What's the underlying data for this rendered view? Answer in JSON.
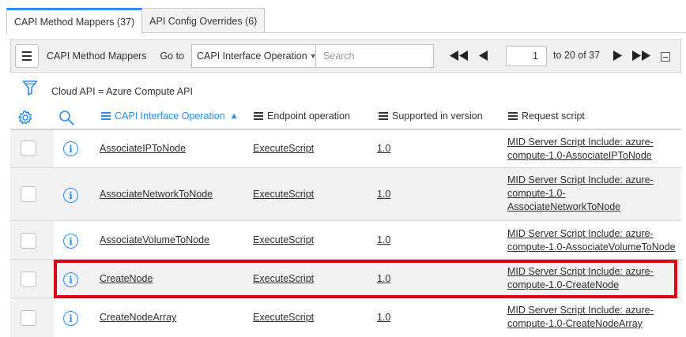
{
  "tabs": [
    {
      "label": "CAPI Method Mappers (37)",
      "active": true
    },
    {
      "label": "API Config Overrides (6)",
      "active": false
    }
  ],
  "toolbar": {
    "title": "CAPI Method Mappers",
    "goto_label": "Go to",
    "goto_field": "CAPI Interface Operation",
    "search_placeholder": "Search",
    "page_value": "1",
    "page_range": "to 20 of 37"
  },
  "filter": {
    "breadcrumb": "Cloud API = Azure Compute API"
  },
  "columns": {
    "operation": "CAPI Interface Operation",
    "endpoint": "Endpoint operation",
    "version": "Supported in version",
    "script": "Request script"
  },
  "rows": [
    {
      "operation": "AssociateIPToNode",
      "endpoint": "ExecuteScript",
      "version": "1.0",
      "script": [
        "MID Server Script Include: azure-",
        "compute-1.0-AssociateIPToNode"
      ]
    },
    {
      "operation": "AssociateNetworkToNode",
      "endpoint": "ExecuteScript",
      "version": "1.0",
      "script": [
        "MID Server Script Include: azure-",
        "compute-1.0-",
        "AssociateNetworkToNode"
      ]
    },
    {
      "operation": "AssociateVolumeToNode",
      "endpoint": "ExecuteScript",
      "version": "1.0",
      "script": [
        "MID Server Script Include: azure-",
        "compute-1.0-AssociateVolumeToNode"
      ]
    },
    {
      "operation": "CreateNode",
      "endpoint": "ExecuteScript",
      "version": "1.0",
      "script": [
        "MID Server Script Include: azure-",
        "compute-1.0-CreateNode"
      ]
    },
    {
      "operation": "CreateNodeArray",
      "endpoint": "ExecuteScript",
      "version": "1.0",
      "script": [
        "MID Server Script Include: azure-",
        "compute-1.0-CreateNodeArray"
      ]
    }
  ],
  "colors": {
    "accent": "#278efc",
    "highlight": "#e0000f",
    "alt_row": "#f2f2f2"
  },
  "icons": [
    "menu-icon",
    "first-page-icon",
    "prev-page-icon",
    "next-page-icon",
    "last-page-icon",
    "collapse-icon",
    "filter-icon",
    "gear-icon",
    "search-icon",
    "info-icon"
  ]
}
